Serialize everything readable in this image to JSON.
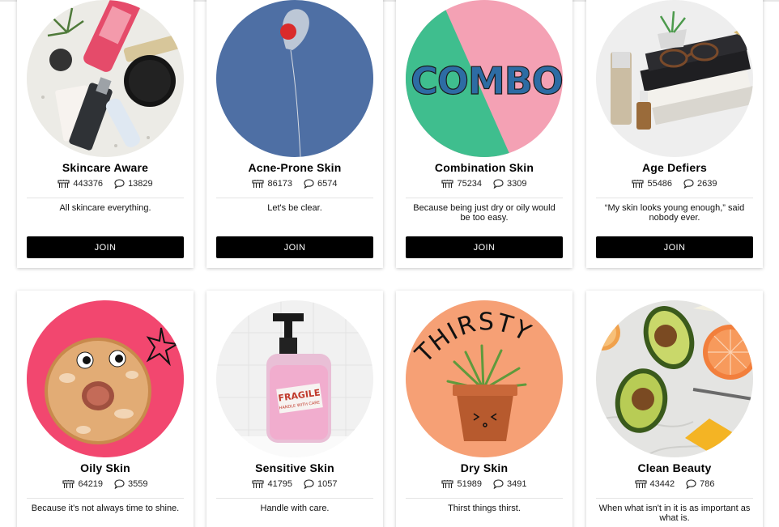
{
  "groups": [
    {
      "name": "Skincare Aware",
      "members": "443376",
      "posts": "13829",
      "description": "All skincare everything.",
      "join_label": "JOIN",
      "image_icon": "skincare-products-image"
    },
    {
      "name": "Acne-Prone Skin",
      "members": "86173",
      "posts": "6574",
      "description": "Let's be clear.",
      "join_label": "JOIN",
      "image_icon": "balloon-image"
    },
    {
      "name": "Combination Skin",
      "members": "75234",
      "posts": "3309",
      "description": "Because being just dry or oily would be too easy.",
      "join_label": "JOIN",
      "image_icon": "combo-letters-image",
      "image_text": "COMBO"
    },
    {
      "name": "Age Defiers",
      "members": "55486",
      "posts": "2639",
      "description": "“My skin looks young enough,” said nobody ever.",
      "join_label": "JOIN",
      "image_icon": "books-glasses-image"
    },
    {
      "name": "Oily Skin",
      "members": "64219",
      "posts": "3559",
      "description": "Because it's not always time to shine.",
      "image_icon": "glazed-donut-image"
    },
    {
      "name": "Sensitive Skin",
      "members": "41795",
      "posts": "1057",
      "description": "Handle with care.",
      "image_icon": "fragile-pump-bottle-image",
      "image_text": "FRAGILE",
      "image_subtext": "HANDLE WITH CARE"
    },
    {
      "name": "Dry Skin",
      "members": "51989",
      "posts": "3491",
      "description": "Thirst things thirst.",
      "image_icon": "thirsty-plant-image",
      "image_text": "THIRSTY"
    },
    {
      "name": "Clean Beauty",
      "members": "43442",
      "posts": "786",
      "description": "When what isn't in it is as important as what is.",
      "image_icon": "avocado-citrus-image"
    }
  ],
  "icons": {
    "members": "members-icon",
    "posts": "comment-bubble-icon"
  }
}
